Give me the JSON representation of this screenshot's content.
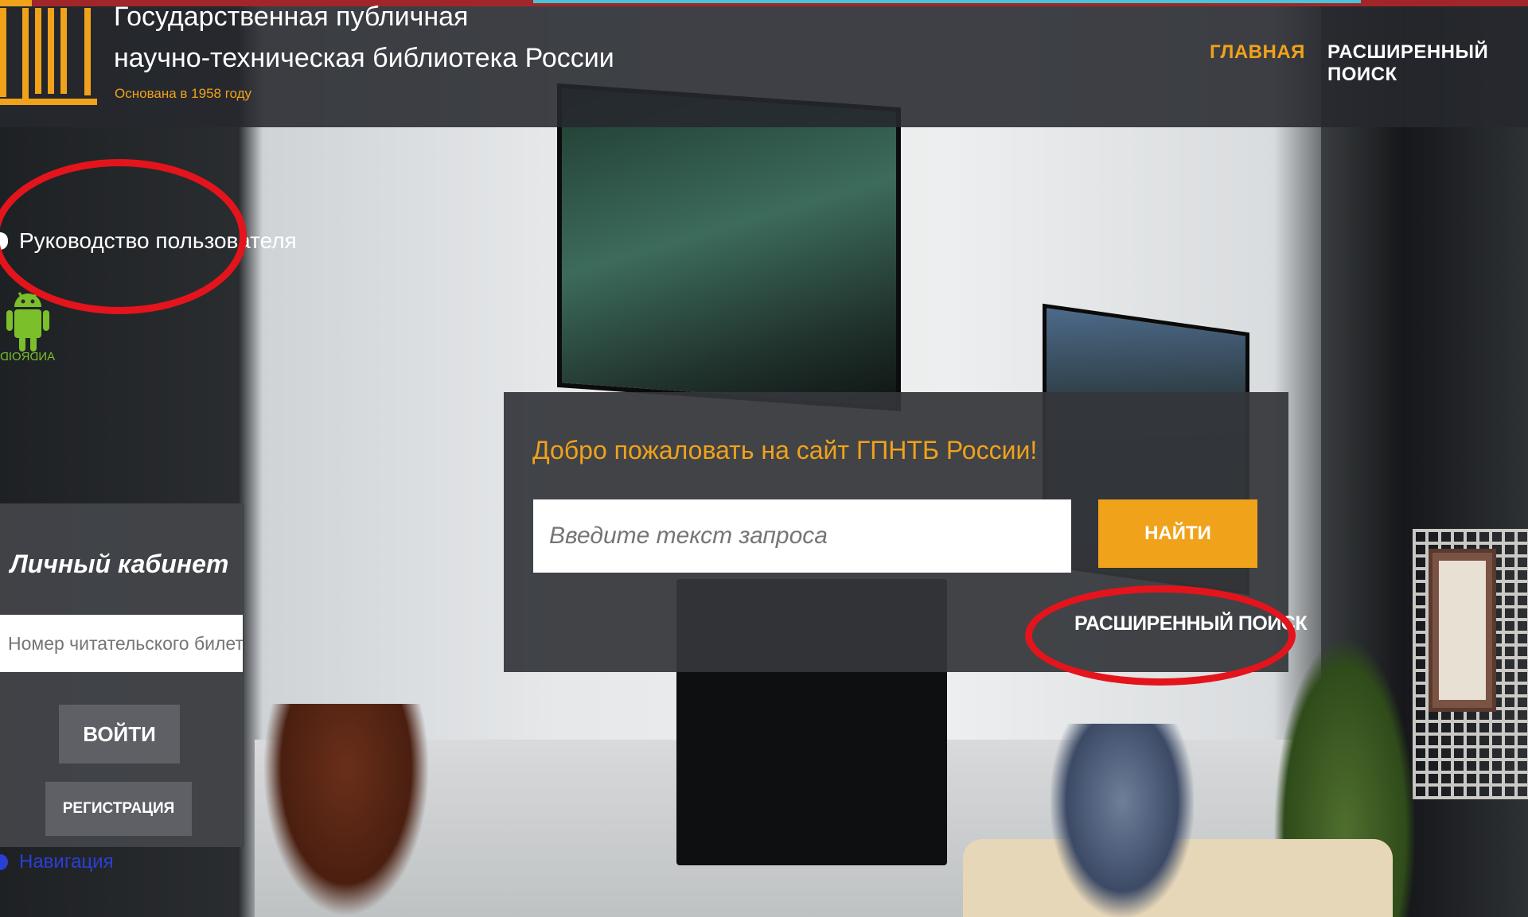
{
  "header": {
    "title_line1": "Государственная публичная",
    "title_line2": "научно-техническая библиотека России",
    "subtitle": "Основана в 1958 году"
  },
  "nav": {
    "home": "ГЛАВНАЯ",
    "advanced_search": "РАСШИРЕННЫЙ ПОИСК"
  },
  "sidebar": {
    "user_guide": "Руководство пользователя",
    "android_label": "ANDROID",
    "navigation": "Навигация"
  },
  "cabinet": {
    "title": "Личный кабинет",
    "card_placeholder": "Номер читательского билета",
    "login": "ВОЙТИ",
    "register": "РЕГИСТРАЦИЯ"
  },
  "search": {
    "welcome": "Добро пожаловать на сайт ГПНТБ России!",
    "placeholder": "Введите текст запроса",
    "find": "НАЙТИ",
    "advanced": "РАСШИРЕННЫЙ ПОИСК"
  },
  "colors": {
    "accent": "#f0a21a",
    "annotation": "#e4141c",
    "link": "#2a3fd8"
  }
}
